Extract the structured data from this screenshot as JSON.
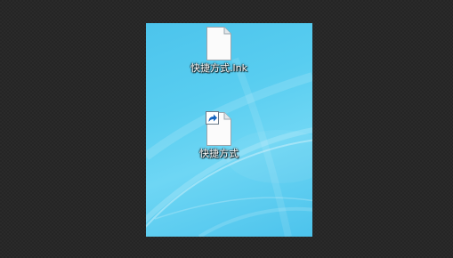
{
  "desktop": {
    "icons": [
      {
        "label": "快捷方式.lnk",
        "icon": "blank-file-icon",
        "shortcut": false
      },
      {
        "label": "快捷方式",
        "icon": "blank-file-icon",
        "shortcut": true,
        "overlay": "shortcut-arrow-icon"
      }
    ]
  },
  "colors": {
    "outer_background": "#252525",
    "desktop_background": "#58cdf0",
    "label_text": "#ffffff",
    "shortcut_arrow": "#1565c0"
  }
}
